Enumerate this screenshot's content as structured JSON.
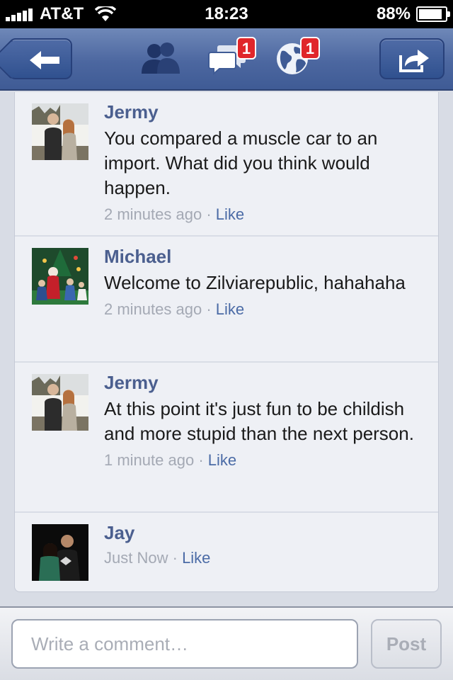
{
  "status_bar": {
    "carrier": "AT&T",
    "time": "18:23",
    "battery_percent": "88%",
    "battery_level": 0.88,
    "signal_bars": 5
  },
  "nav": {
    "back_icon": "left-arrow-icon",
    "friends_icon": "friends-icon",
    "messages_icon": "messages-icon",
    "messages_badge": "1",
    "notifications_icon": "globe-icon",
    "notifications_badge": "1",
    "share_icon": "share-icon"
  },
  "comments": [
    {
      "name": "Jermy",
      "text": "You compared a muscle car to an import. What did you think would happen.",
      "time": "2 minutes ago",
      "like": "Like"
    },
    {
      "name": "Michael",
      "text": "Welcome to Zilviarepublic, hahahaha",
      "time": "2 minutes ago",
      "like": "Like"
    },
    {
      "name": "Jermy",
      "text": "At this point it's just fun to be childish and more stupid than the next person.",
      "time": "1 minute ago",
      "like": "Like"
    },
    {
      "name": "Jay",
      "text": "",
      "time": "Just Now",
      "like": "Like"
    }
  ],
  "meta_separator": "·",
  "compose": {
    "placeholder": "Write a comment…",
    "post_label": "Post"
  },
  "colors": {
    "nav_blue": "#4c67a0",
    "name_blue": "#4b5f8f",
    "badge_red": "#e0262a"
  }
}
